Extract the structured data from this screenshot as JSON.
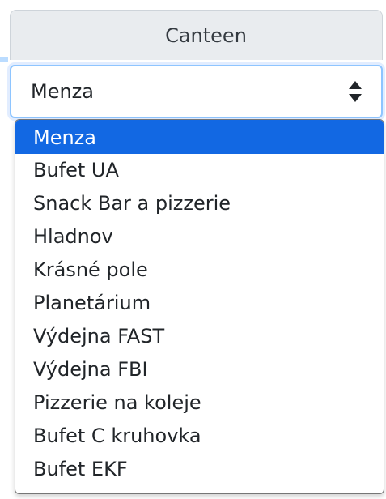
{
  "field": {
    "label": "Canteen",
    "selected_value": "Menza"
  },
  "dropdown": {
    "options": [
      "Menza",
      "Bufet UA",
      "Snack Bar a pizzerie",
      "Hladnov",
      "Krásné pole",
      "Planetárium",
      "Výdejna FAST",
      "Výdejna FBI",
      "Pizzerie na koleje",
      "Bufet C kruhovka",
      "Bufet EKF"
    ],
    "selected_index": 0
  },
  "icons": {
    "select_arrows": "up-down-arrows-icon"
  },
  "colors": {
    "highlight": "#1268e3",
    "focus_border": "#8ec5ff",
    "label_bg": "#e9ecef"
  }
}
